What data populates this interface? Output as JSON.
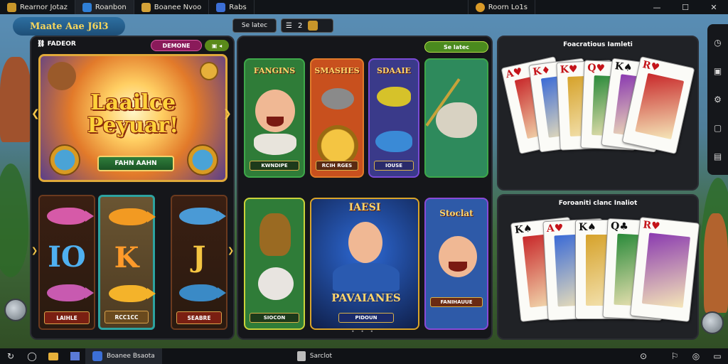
{
  "tabs": [
    {
      "label": "Rearnor Jotaz",
      "icon": "treasure-chest-icon",
      "color": "#c8962a"
    },
    {
      "label": "Roanbon",
      "icon": "window-icon",
      "color": "#2f7fd6"
    },
    {
      "label": "Boanee Nvoo",
      "icon": "game-icon",
      "color": "#d4a238"
    },
    {
      "label": "Rabs",
      "icon": "game-icon",
      "color": "#3c6fd6"
    },
    {
      "label": "Roorn Lo1s",
      "icon": "coin-icon",
      "color": "#d99a28"
    }
  ],
  "window_controls": [
    "—",
    "☐",
    "✕"
  ],
  "header": {
    "app_title": "Maate Aae J6l3",
    "select_label": "Se latec",
    "stepper_value": "2"
  },
  "left_panel": {
    "label": "FADEOR",
    "badge": "DEMONE",
    "hero_title": "Laailce Peyuar!",
    "hero_button": "FAHN AAHN",
    "slots": [
      {
        "letter": "IO",
        "caption": "LAIHLE",
        "color": "#4fb0f0"
      },
      {
        "letter": "K",
        "caption": "RCC1CC",
        "color": "#ff9a2a"
      },
      {
        "letter": "J",
        "caption": "SEABRE",
        "color": "#f4c542"
      }
    ]
  },
  "middle_panel": {
    "control_label": "Se latec",
    "games": [
      {
        "title": "FANGINS",
        "caption": "KWNDIPE",
        "bg": "#2f7c38",
        "border": "#3ea84a"
      },
      {
        "title": "SMASHES",
        "caption": "RCIH RGES",
        "bg": "#c8501e",
        "border": "#e07a2a"
      },
      {
        "title": "SDAAIE",
        "caption": "IOUSE",
        "bg": "#3a3a8a",
        "border": "#7a4ad6"
      },
      {
        "title": "",
        "caption": "",
        "bg": "#2e8a5c",
        "border": "#3ea84a"
      },
      {
        "title": "",
        "caption": "SIOCON",
        "bg": "#2f7c38",
        "border": "#c9d23a"
      },
      {
        "title": "PAVAIANES",
        "caption": "PIDOUN",
        "bg": "#1b3c8a",
        "border": "#d9a42a",
        "subtitle": "IAESI"
      },
      {
        "title": "Stoclat",
        "caption": "FANIHAUUE",
        "bg": "#2e5aa8",
        "border": "#8a4ad6"
      }
    ]
  },
  "right_top": {
    "title": "Foacratious Iamleti"
  },
  "right_bottom": {
    "title": "Foroaniti clanc Inaliot"
  },
  "cards_top": [
    {
      "rank": "A",
      "suit": "♥",
      "color": "red"
    },
    {
      "rank": "K",
      "suit": "♦",
      "color": "red"
    },
    {
      "rank": "K",
      "suit": "♥",
      "color": "red"
    },
    {
      "rank": "Q",
      "suit": "♥",
      "color": "red"
    },
    {
      "rank": "K",
      "suit": "♠",
      "color": "blk"
    },
    {
      "rank": "R",
      "suit": "♥",
      "color": "red"
    }
  ],
  "cards_bottom": [
    {
      "rank": "K",
      "suit": "♠",
      "color": "blk"
    },
    {
      "rank": "A",
      "suit": "♥",
      "color": "red"
    },
    {
      "rank": "K",
      "suit": "♠",
      "color": "blk"
    },
    {
      "rank": "Q",
      "suit": "♣",
      "color": "blk"
    },
    {
      "rank": "R",
      "suit": "♥",
      "color": "red"
    }
  ],
  "rail_icons": [
    "clock-icon",
    "panel-icon",
    "settings-icon",
    "image-icon",
    "layout-icon"
  ],
  "taskbar": {
    "start_icon": "↻",
    "apps": [
      {
        "label": "Boanee Bsaota",
        "active": true
      },
      {
        "label": "Sarclot",
        "active": false
      }
    ],
    "tray": [
      "⊙",
      "⚐",
      "◎",
      "▭"
    ]
  }
}
